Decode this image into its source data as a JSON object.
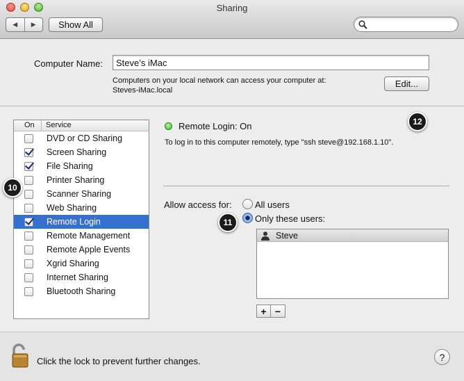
{
  "window": {
    "title": "Sharing"
  },
  "toolbar": {
    "back_glyph": "◀",
    "forward_glyph": "▶",
    "show_all_label": "Show All",
    "search_icon": "search-icon"
  },
  "computer": {
    "name_label": "Computer Name:",
    "name_value": "Steve’s iMac",
    "info_line1": "Computers on your local network can access your computer at:",
    "info_line2": "Steves-iMac.local",
    "edit_label": "Edit..."
  },
  "services": {
    "header_on": "On",
    "header_service": "Service",
    "items": [
      {
        "label": "DVD or CD Sharing",
        "checked": false,
        "selected": false
      },
      {
        "label": "Screen Sharing",
        "checked": true,
        "selected": false
      },
      {
        "label": "File Sharing",
        "checked": true,
        "selected": false
      },
      {
        "label": "Printer Sharing",
        "checked": false,
        "selected": false
      },
      {
        "label": "Scanner Sharing",
        "checked": false,
        "selected": false
      },
      {
        "label": "Web Sharing",
        "checked": false,
        "selected": false
      },
      {
        "label": "Remote Login",
        "checked": true,
        "selected": true
      },
      {
        "label": "Remote Management",
        "checked": false,
        "selected": false
      },
      {
        "label": "Remote Apple Events",
        "checked": false,
        "selected": false
      },
      {
        "label": "Xgrid Sharing",
        "checked": false,
        "selected": false
      },
      {
        "label": "Internet Sharing",
        "checked": false,
        "selected": false
      },
      {
        "label": "Bluetooth Sharing",
        "checked": false,
        "selected": false
      }
    ]
  },
  "detail": {
    "status": "Remote Login: On",
    "status_color": "#3bb52a",
    "login_hint": "To log in to this computer remotely, type \"ssh steve@192.168.1.10\".",
    "allow_label": "Allow access for:",
    "option_all": "All users",
    "option_only": "Only these users:",
    "selected_option": "only",
    "users": [
      "Steve"
    ],
    "add_label": "+",
    "remove_label": "−"
  },
  "footer": {
    "lock_text": "Click the lock to prevent further changes.",
    "help_label": "?"
  },
  "callouts": {
    "a": "10",
    "b": "11",
    "c": "12"
  }
}
